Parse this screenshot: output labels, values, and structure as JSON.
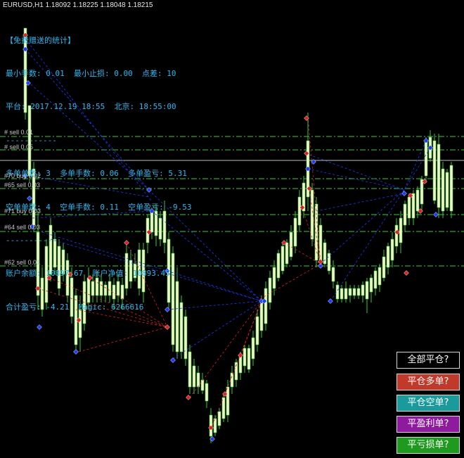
{
  "symbol_bar": {
    "text": "EURUSD,H1  1.18092 1.18225 1.18048 1.18215"
  },
  "info_panel": {
    "lines": [
      "【免费赠送的统计】",
      "最小手数: 0.01  最小止损: 0.00  点差: 10",
      "平台: 2017.12.19 18:55  北京: 18:55:00",
      "-----------",
      "多单单数: 3  多单手数: 0.06  多单盈亏: 5.31",
      "空单单数: 4  空单手数: 0.11  空单盈亏: -9.53",
      "-----------",
      "账户余额: 10897.67  账户净值: 10893.45",
      "合计盈亏: -4.21  Magic: 6266616"
    ]
  },
  "order_lines": [
    {
      "label": "#   sell 0.01"
    },
    {
      "label": "#   sell 0.05"
    },
    {
      "label": "#70 buy  0.02"
    },
    {
      "label": "#65 sell 0.03"
    },
    {
      "label": "#71 buy  0.03"
    },
    {
      "label": "#64 sell 0.03"
    },
    {
      "label": "#62 sell 0.01"
    }
  ],
  "buttons": [
    {
      "label": "全部平仓?",
      "color": "#000000"
    },
    {
      "label": "平仓多单?",
      "color": "#c0392b"
    },
    {
      "label": "平仓空单?",
      "color": "#1a9a9a"
    },
    {
      "label": "平盈利单?",
      "color": "#8e1a9e"
    },
    {
      "label": "平亏损单?",
      "color": "#1e9a1e"
    }
  ],
  "colors": {
    "background": "#000000",
    "bull_candle": "#f4f4cc",
    "wick": "#33cc33",
    "order_line": "#33cc33",
    "current_price_line": "#bfbfbf",
    "buy_arrow": "#1a3cff",
    "sell_arrow": "#e02020"
  }
}
